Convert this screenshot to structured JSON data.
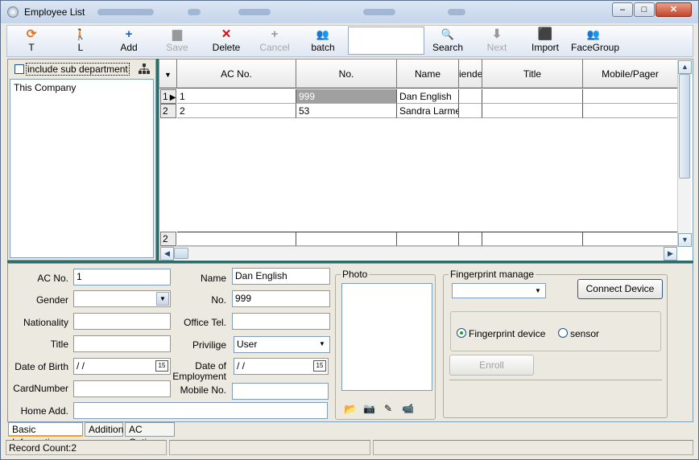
{
  "window": {
    "title": "Employee List",
    "controls": [
      "–",
      "□",
      "✕"
    ]
  },
  "toolbar": {
    "buttons": [
      {
        "label": "T",
        "icon": "refresh-icon",
        "glyph": "⟳",
        "enabled": true,
        "color": "#e07020"
      },
      {
        "label": "L",
        "icon": "person-run-icon",
        "glyph": "🚶",
        "enabled": true,
        "color": "#c03030"
      },
      {
        "label": "Add",
        "icon": "plus-icon",
        "glyph": "+",
        "enabled": true,
        "color": "#1a5fc0"
      },
      {
        "label": "Save",
        "icon": "save-icon",
        "glyph": "▆",
        "enabled": false,
        "color": "#999"
      },
      {
        "label": "Delete",
        "icon": "x-icon",
        "glyph": "✕",
        "enabled": true,
        "color": "#d01010"
      },
      {
        "label": "Cancel",
        "icon": "plus-icon",
        "glyph": "+",
        "enabled": false,
        "color": "#999"
      },
      {
        "label": "batch",
        "icon": "people-group-icon",
        "glyph": "👥",
        "enabled": true,
        "color": "#30a030"
      },
      {
        "label": "Search",
        "icon": "search-icon",
        "glyph": "🔍",
        "enabled": true,
        "color": "#777"
      },
      {
        "label": "Next",
        "icon": "arrow-down-icon",
        "glyph": "⬇",
        "enabled": false,
        "color": "#999"
      },
      {
        "label": "Import",
        "icon": "import-icon",
        "glyph": "⬛",
        "enabled": true,
        "color": "#c020a0"
      },
      {
        "label": "FaceGroup",
        "icon": "people-group-icon",
        "glyph": "👥",
        "enabled": true,
        "color": "#30a030"
      }
    ],
    "search_value": ""
  },
  "department": {
    "include_sub_label": "include sub department",
    "include_sub_checked": false,
    "tree_nodes": [
      "This Company"
    ]
  },
  "grid": {
    "columns": [
      "AC No.",
      "No.",
      "Name",
      "iende",
      "Title",
      "Mobile/Pager"
    ],
    "rows": [
      {
        "row_num": "1",
        "ac_no": "1",
        "no": "999",
        "name": "Dan English",
        "gender": "",
        "title": "",
        "mobile": ""
      },
      {
        "row_num": "2",
        "ac_no": "2",
        "no": "53",
        "name": "Sandra Larmer",
        "gender": "",
        "title": "",
        "mobile": ""
      }
    ],
    "footer_row_num": "2"
  },
  "form": {
    "labels": {
      "ac_no": "AC No.",
      "gender": "Gender",
      "nationality": "Nationality",
      "title": "Title",
      "dob": "Date of Birth",
      "card_number": "CardNumber",
      "home_add": "Home Add.",
      "name": "Name",
      "no": "No.",
      "office_tel": "Office Tel.",
      "privilige": "Privilige",
      "date_employment": "Date of Employment",
      "mobile_no": "Mobile No.",
      "photo": "Photo"
    },
    "values": {
      "ac_no": "1",
      "gender": "",
      "nationality": "",
      "title": "",
      "dob": " /  /",
      "card_number": "",
      "home_add": "",
      "name": "Dan English",
      "no": "999",
      "office_tel": "",
      "privilige": "User",
      "date_employment": " /  /",
      "mobile_no": ""
    }
  },
  "fingerprint": {
    "group_title": "Fingerprint manage",
    "device_select": "",
    "connect_label": "Connect Device",
    "radio_device": "Fingerprint device",
    "radio_sensor": "sensor",
    "selected": "device",
    "enroll_label": "Enroll"
  },
  "tabs": [
    "Basic Information",
    "Addition",
    "AC Options"
  ],
  "status": {
    "record_count": "Record Count:2",
    "panel2": "",
    "panel3": ""
  }
}
